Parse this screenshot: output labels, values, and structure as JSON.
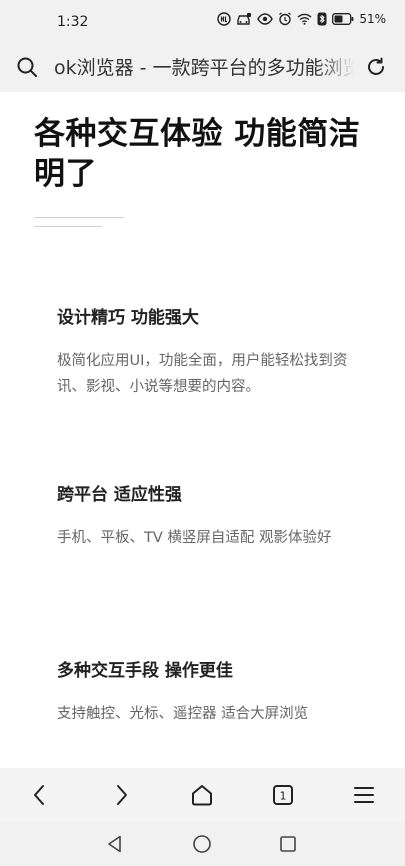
{
  "status_bar": {
    "time": "1:32",
    "battery": "51%",
    "icons": [
      "hd-voice-icon",
      "car-icon",
      "eye-icon",
      "alarm-icon",
      "wifi-icon",
      "bluetooth-icon",
      "battery-icon"
    ]
  },
  "address_bar": {
    "url_title": "ok浏览器 - 一款跨平台的多功能浏览器"
  },
  "hero": {
    "title": "各种交互体验 功能简洁明了"
  },
  "features": [
    {
      "heading": "设计精巧 功能强大",
      "description": "极简化应用UI，功能全面，用户能轻松找到资讯、影视、小说等想要的内容。"
    },
    {
      "heading": "跨平台 适应性强",
      "description": "手机、平板、TV 横竖屏自适配 观影体验好"
    },
    {
      "heading": "多种交互手段 操作更佳",
      "description": "支持触控、光标、遥控器 适合大屏浏览"
    }
  ],
  "toolbar": {
    "tab_count": "1"
  },
  "colors": {
    "chrome_background": "#f1f1f1",
    "page_background": "#ffffff",
    "heading_text": "#111111",
    "body_text": "#666666"
  }
}
